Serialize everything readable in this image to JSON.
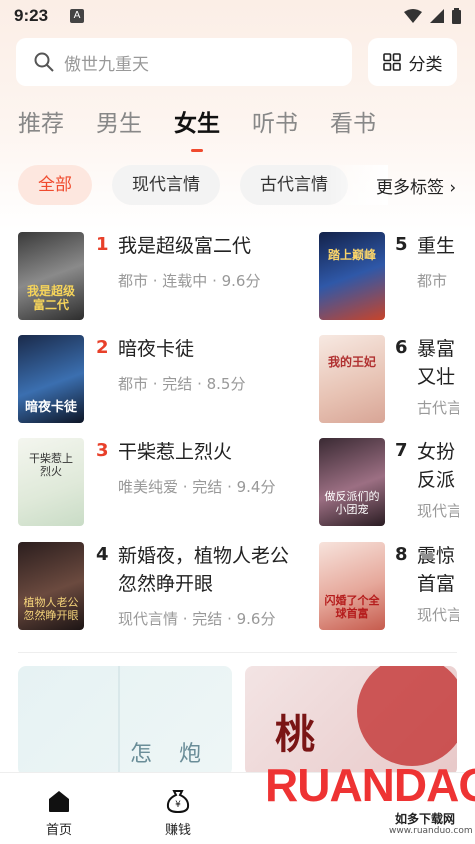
{
  "status": {
    "time": "9:23",
    "notif_letter": "A"
  },
  "search": {
    "placeholder": "傲世九重天"
  },
  "category_button": {
    "label": "分类"
  },
  "tabs": [
    {
      "label": "推荐",
      "active": false
    },
    {
      "label": "男生",
      "active": false
    },
    {
      "label": "女生",
      "active": true
    },
    {
      "label": "听书",
      "active": false
    },
    {
      "label": "看书",
      "active": false
    }
  ],
  "chips": [
    {
      "label": "全部",
      "active": true
    },
    {
      "label": "现代言情",
      "active": false
    },
    {
      "label": "古代言情",
      "active": false
    }
  ],
  "more_tags": "更多标签 ›",
  "ranking_left": [
    {
      "rank": "1",
      "title": "我是超级富二代",
      "meta": "都市 · 连载中 · 9.6分",
      "cover_text": "我是超级富二代"
    },
    {
      "rank": "2",
      "title": "暗夜卡徒",
      "meta": "都市 · 完结 · 8.5分",
      "cover_text": "暗夜卡徒"
    },
    {
      "rank": "3",
      "title": "干柴惹上烈火",
      "meta": "唯美纯爱 · 完结 · 9.4分",
      "cover_text": "干柴惹上烈火"
    },
    {
      "rank": "4",
      "title": "新婚夜，植物人老公忽然睁开眼",
      "meta": "现代言情 · 完结 · 9.6分",
      "cover_text": "植物人老公忽然睁开眼"
    }
  ],
  "ranking_right": [
    {
      "rank": "5",
      "title": "重生",
      "meta": "都市",
      "cover_text": "踏上巅峰"
    },
    {
      "rank": "6",
      "title": "暴富又壮",
      "meta": "古代言",
      "cover_text": "我的王妃"
    },
    {
      "rank": "7",
      "title": "女扮反派",
      "meta": "现代言",
      "cover_text": "做反派们的小团宠"
    },
    {
      "rank": "8",
      "title": "震惊首富",
      "meta": "现代言",
      "cover_text": "闪婚了个全球首富"
    }
  ],
  "banner1_text": "怎 炮",
  "banner2_text": "桃",
  "nav": [
    {
      "label": "首页",
      "icon": "home-icon"
    },
    {
      "label": "赚钱",
      "icon": "money-bag-icon"
    }
  ],
  "watermark": {
    "brand": "RUANDAO",
    "cn": "如多下载网",
    "url": "www.ruanduo.com"
  },
  "colors": {
    "accent": "#f04b2e",
    "rank_red": "#e8402a"
  }
}
